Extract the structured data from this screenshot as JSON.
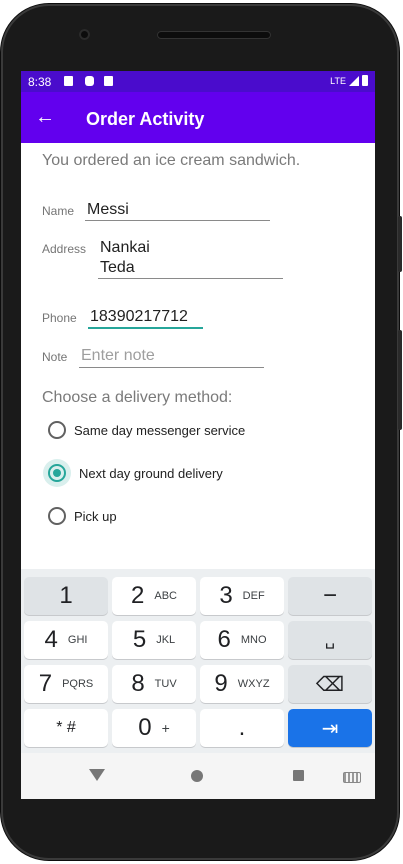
{
  "status_bar": {
    "time": "8:38",
    "network": "LTE"
  },
  "app_bar": {
    "back_icon": "arrow-left",
    "title": "Order Activity"
  },
  "order": {
    "summary": "You ordered an ice cream sandwich.",
    "name_label": "Name",
    "name_value": "Messi",
    "address_label": "Address",
    "address_line1": "Nankai",
    "address_line2": "Teda",
    "phone_label": "Phone",
    "phone_value": "18390217712",
    "note_label": "Note",
    "note_placeholder": "Enter note"
  },
  "delivery": {
    "prompt": "Choose a delivery method:",
    "options": [
      {
        "label": "Same day messenger service",
        "checked": false
      },
      {
        "label": "Next day ground delivery",
        "checked": true
      },
      {
        "label": "Pick up",
        "checked": false
      }
    ]
  },
  "keyboard": {
    "keys": [
      {
        "digit": "1",
        "sub": ""
      },
      {
        "digit": "2",
        "sub": "ABC"
      },
      {
        "digit": "3",
        "sub": "DEF"
      },
      {
        "digit": "−",
        "sub": ""
      },
      {
        "digit": "4",
        "sub": "GHI"
      },
      {
        "digit": "5",
        "sub": "JKL"
      },
      {
        "digit": "6",
        "sub": "MNO"
      },
      {
        "digit": "␣",
        "sub": ""
      },
      {
        "digit": "7",
        "sub": "PQRS"
      },
      {
        "digit": "8",
        "sub": "TUV"
      },
      {
        "digit": "9",
        "sub": "WXYZ"
      },
      {
        "digit": "⌫",
        "sub": ""
      },
      {
        "digit": "* #",
        "sub": ""
      },
      {
        "digit": "0",
        "sub": "+"
      },
      {
        "digit": ".",
        "sub": ""
      },
      {
        "digit": "⇥",
        "sub": ""
      }
    ]
  },
  "colors": {
    "status_bar": "#4a0ccc",
    "app_bar": "#6200ee",
    "accent": "#26a69a",
    "keyboard_action": "#1a73e8"
  }
}
